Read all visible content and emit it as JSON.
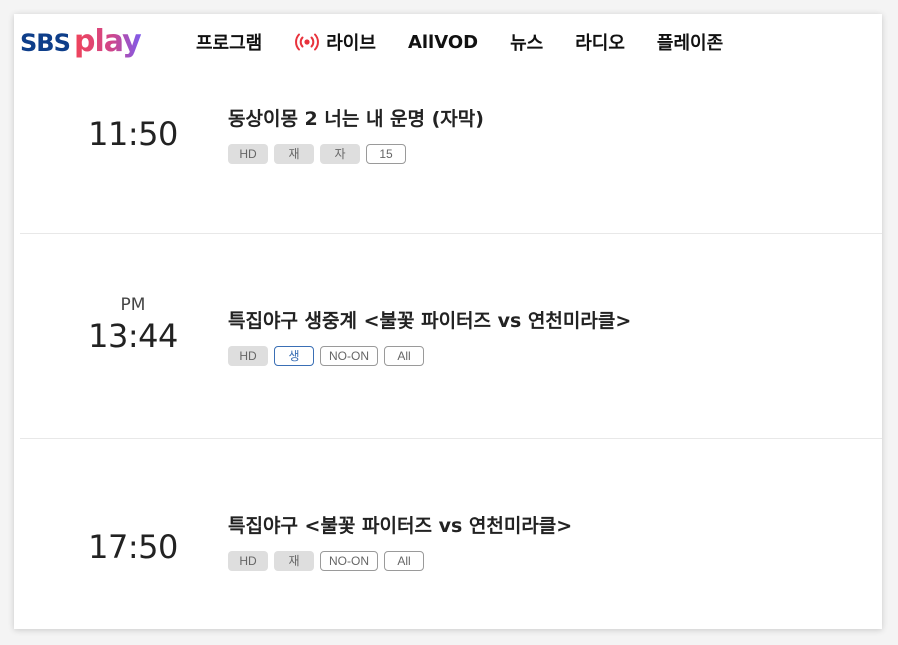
{
  "header": {
    "logo_text": "SBS play",
    "nav": [
      {
        "label": "프로그램"
      },
      {
        "label": "라이브",
        "icon": "live-broadcast-icon"
      },
      {
        "label": "AllVOD"
      },
      {
        "label": "뉴스"
      },
      {
        "label": "라디오"
      },
      {
        "label": "플레이존"
      }
    ]
  },
  "colors": {
    "brand_sbs": "#0e3e8a",
    "brand_play_start": "#f0445a",
    "brand_play_end": "#7a5cf0",
    "live_red": "#e8323c",
    "badge_blue": "#3a6fb5"
  },
  "schedule": [
    {
      "ampm": "",
      "time": "11:50",
      "title": "동상이몽 2 너는 내 운명 (자막)",
      "badges": [
        {
          "label": "HD",
          "style": "gray"
        },
        {
          "label": "재",
          "style": "gray"
        },
        {
          "label": "자",
          "style": "gray"
        },
        {
          "label": "15",
          "style": "outline"
        }
      ]
    },
    {
      "ampm": "PM",
      "time": "13:44",
      "title": "특집야구 생중계 <불꽃 파이터즈 vs 연천미라클>",
      "badges": [
        {
          "label": "HD",
          "style": "gray"
        },
        {
          "label": "생",
          "style": "blue"
        },
        {
          "label": "NO-ON",
          "style": "outline"
        },
        {
          "label": "All",
          "style": "outline"
        }
      ]
    },
    {
      "ampm": "",
      "time": "17:50",
      "title": "특집야구 <불꽃 파이터즈 vs 연천미라클>",
      "badges": [
        {
          "label": "HD",
          "style": "gray"
        },
        {
          "label": "재",
          "style": "gray"
        },
        {
          "label": "NO-ON",
          "style": "outline"
        },
        {
          "label": "All",
          "style": "outline"
        }
      ]
    }
  ]
}
